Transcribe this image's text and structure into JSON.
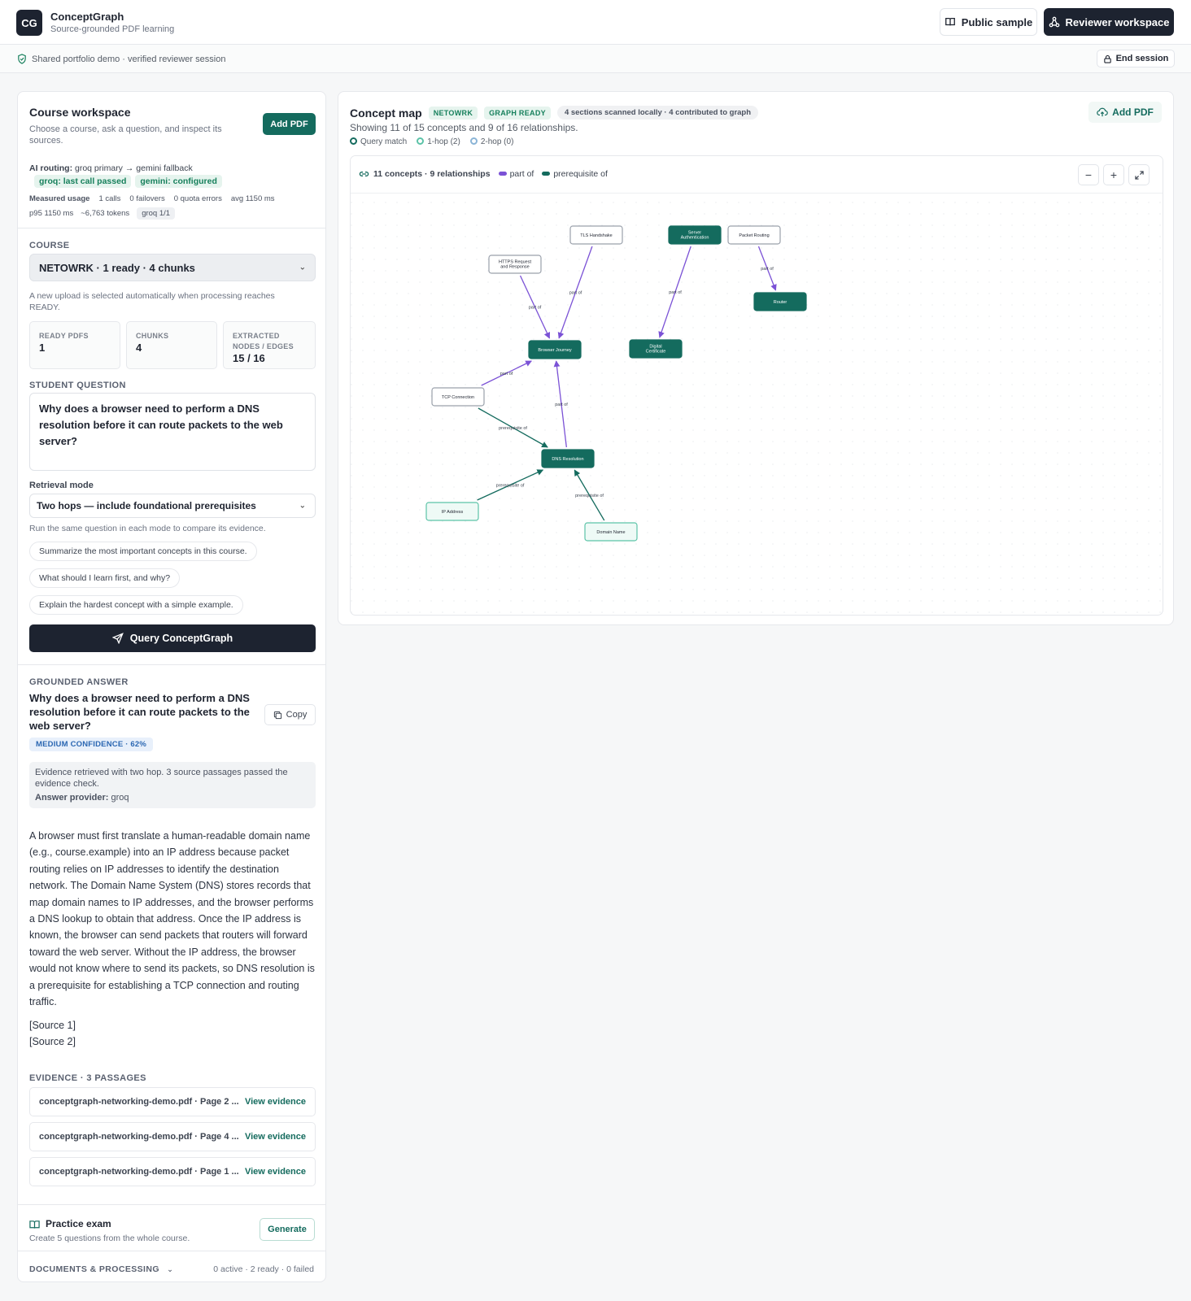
{
  "app": {
    "logo": "CG",
    "name": "ConceptGraph",
    "tagline": "Source-grounded PDF learning",
    "public_sample": "Public sample",
    "reviewer_workspace": "Reviewer workspace"
  },
  "session": {
    "status": "Shared portfolio demo · verified reviewer session",
    "end": "End session"
  },
  "workspace": {
    "title": "Course workspace",
    "subtitle": "Choose a course, ask a question, and inspect its sources.",
    "add_pdf": "Add PDF",
    "routing_label": "AI routing:",
    "routing_value": "groq primary → gemini fallback",
    "groq_status": "groq: last call passed",
    "gemini_status": "gemini: configured",
    "usage_label": "Measured usage",
    "usage_calls": "1 calls",
    "usage_failovers": "0 failovers",
    "usage_quota": "0 quota errors",
    "usage_avg": "avg 1150 ms",
    "usage_p95": "p95 1150 ms",
    "usage_tokens": "~6,763 tokens",
    "usage_chip": "groq 1/1"
  },
  "course": {
    "label": "Course",
    "selected": "NETOWRK · 1 ready · 4 chunks",
    "hint": "A new upload is selected automatically when processing reaches READY.",
    "stats": [
      {
        "label": "READY PDFS",
        "value": "1"
      },
      {
        "label": "CHUNKS",
        "value": "4"
      },
      {
        "label": "EXTRACTED NODES / EDGES",
        "value": "15 / 16"
      }
    ]
  },
  "question": {
    "label": "Student question",
    "text": "Why does a browser need to perform a DNS resolution before it can route packets to the web server?",
    "mode_label": "Retrieval mode",
    "mode_value": "Two hops — include foundational prerequisites",
    "mode_hint": "Run the same question in each mode to compare its evidence.",
    "suggestions": [
      "Summarize the most important concepts in this course.",
      "What should I learn first, and why?",
      "Explain the hardest concept with a simple example."
    ],
    "submit": "Query ConceptGraph"
  },
  "answer": {
    "label": "Grounded answer",
    "title": "Why does a browser need to perform a DNS resolution before it can route packets to the web server?",
    "copy": "Copy",
    "confidence": "MEDIUM CONFIDENCE · 62%",
    "note": "Evidence retrieved with two hop. 3 source passages passed the evidence check.",
    "provider_label": "Answer provider:",
    "provider_value": "groq",
    "body": "A browser must first translate a human-readable domain name (e.g., course.example) into an IP address because packet routing relies on IP addresses to identify the destination network. The Domain Name System (DNS) stores records that map domain names to IP addresses, and the browser performs a DNS lookup to obtain that address. Once the IP address is known, the browser can send packets that routers will forward toward the web server. Without the IP address, the browser would not know where to send its packets, so DNS resolution is a prerequisite for establishing a TCP connection and routing traffic.",
    "source1": "[Source 1]",
    "source2": "[Source 2]"
  },
  "evidence": {
    "label": "Evidence · 3 passages",
    "items": [
      {
        "file": "conceptgraph-networking-demo.pdf · Page 2 ...",
        "link": "View evidence"
      },
      {
        "file": "conceptgraph-networking-demo.pdf · Page 4 ...",
        "link": "View evidence"
      },
      {
        "file": "conceptgraph-networking-demo.pdf · Page 1 ...",
        "link": "View evidence"
      }
    ]
  },
  "practice": {
    "title": "Practice exam",
    "subtitle": "Create 5 questions from the whole course.",
    "button": "Generate"
  },
  "documents": {
    "label": "Documents & processing",
    "status": "0 active · 2 ready · 0 failed"
  },
  "map": {
    "title": "Concept map",
    "course_tag": "NETOWRK",
    "ready_tag": "GRAPH READY",
    "scan_tag": "4 sections scanned locally · 4 contributed to graph",
    "showing": "Showing 11 of 15 concepts and 9 of 16 relationships.",
    "legend": [
      "Query match",
      "1-hop (2)",
      "2-hop (0)"
    ],
    "add_pdf": "Add PDF",
    "graph_summary": "11 concepts · 9 relationships",
    "edge_legend": [
      "part of",
      "prerequisite of"
    ],
    "colors": {
      "teal": "#146b5e",
      "purple": "#7b52d6",
      "light_teal": "#5cc3a8"
    },
    "nodes": [
      {
        "id": "tls",
        "label": "TLS Handshake",
        "style": "plain"
      },
      {
        "id": "server_auth",
        "label": "Server Authentication",
        "style": "filled"
      },
      {
        "id": "packet_routing",
        "label": "Packet Routing",
        "style": "plain"
      },
      {
        "id": "https",
        "label": "HTTPS Request and Response",
        "style": "plain"
      },
      {
        "id": "router",
        "label": "Router",
        "style": "filled"
      },
      {
        "id": "browser",
        "label": "Browser Journey",
        "style": "filled"
      },
      {
        "id": "digital_cert",
        "label": "Digital Certificate",
        "style": "filled"
      },
      {
        "id": "tcp",
        "label": "TCP Connection",
        "style": "plain"
      },
      {
        "id": "dns",
        "label": "DNS Resolution",
        "style": "filled"
      },
      {
        "id": "ip",
        "label": "IP Address",
        "style": "light"
      },
      {
        "id": "domain",
        "label": "Domain Name",
        "style": "light"
      }
    ],
    "edges": [
      {
        "from": "https",
        "to": "browser",
        "label": "part of",
        "kind": "part"
      },
      {
        "from": "tls",
        "to": "browser",
        "label": "part of",
        "kind": "part"
      },
      {
        "from": "server_auth",
        "to": "digital_cert",
        "label": "part of",
        "kind": "part"
      },
      {
        "from": "packet_routing",
        "to": "router",
        "label": "part of",
        "kind": "part"
      },
      {
        "from": "tcp",
        "to": "browser",
        "label": "part of",
        "kind": "part"
      },
      {
        "from": "dns",
        "to": "browser",
        "label": "part of",
        "kind": "part"
      },
      {
        "from": "tcp",
        "to": "dns",
        "label": "prerequisite of",
        "kind": "prereq"
      },
      {
        "from": "ip",
        "to": "dns",
        "label": "prerequisite of",
        "kind": "prereq"
      },
      {
        "from": "domain",
        "to": "dns",
        "label": "prerequisite of",
        "kind": "prereq"
      }
    ]
  }
}
